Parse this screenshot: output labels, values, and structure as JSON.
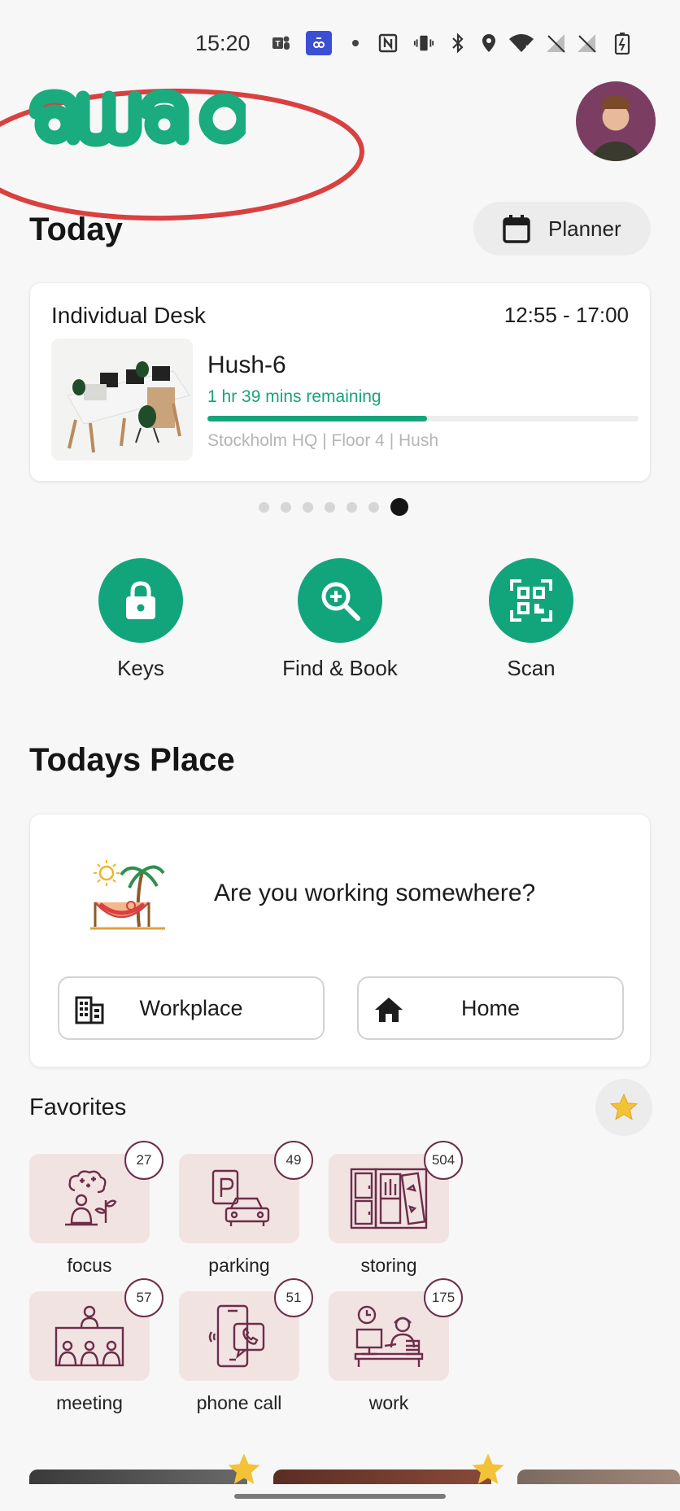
{
  "status_bar": {
    "time": "15:20",
    "icons": [
      "teams-icon",
      "app-icon",
      "dot-icon",
      "nfc-icon",
      "vibrate-icon",
      "bluetooth-icon",
      "location-icon",
      "wifi-icon",
      "no-signal-icon",
      "no-signal-icon",
      "battery-icon"
    ]
  },
  "header": {
    "logo_text": "awaio"
  },
  "today": {
    "title": "Today",
    "planner_label": "Planner",
    "booking": {
      "type": "Individual Desk",
      "time": "12:55 - 17:00",
      "name": "Hush-6",
      "remaining": "1 hr 39 mins remaining",
      "progress": 0.51,
      "location": "Stockholm HQ | Floor 4 | Hush"
    },
    "pager": {
      "count": 7,
      "active": 6
    }
  },
  "actions": [
    {
      "label": "Keys",
      "icon": "lock-icon"
    },
    {
      "label": "Find & Book",
      "icon": "search-plus-icon"
    },
    {
      "label": "Scan",
      "icon": "qr-scan-icon"
    }
  ],
  "todays_place": {
    "title": "Todays Place",
    "question": "Are you working somewhere?",
    "workplace_label": "Workplace",
    "home_label": "Home"
  },
  "favorites": {
    "title": "Favorites",
    "items": [
      {
        "label": "focus",
        "count": "27",
        "icon": "focus-icon"
      },
      {
        "label": "parking",
        "count": "49",
        "icon": "parking-icon"
      },
      {
        "label": "storing",
        "count": "504",
        "icon": "storing-icon"
      },
      {
        "label": "meeting",
        "count": "57",
        "icon": "meeting-icon"
      },
      {
        "label": "phone call",
        "count": "51",
        "icon": "phone-call-icon"
      },
      {
        "label": "work",
        "count": "175",
        "icon": "work-icon"
      }
    ]
  },
  "colors": {
    "accent": "#12a57c",
    "tile_bg": "#f2e3e3",
    "icon_stroke": "#6d2d4a",
    "annotation": "#d9403f"
  }
}
